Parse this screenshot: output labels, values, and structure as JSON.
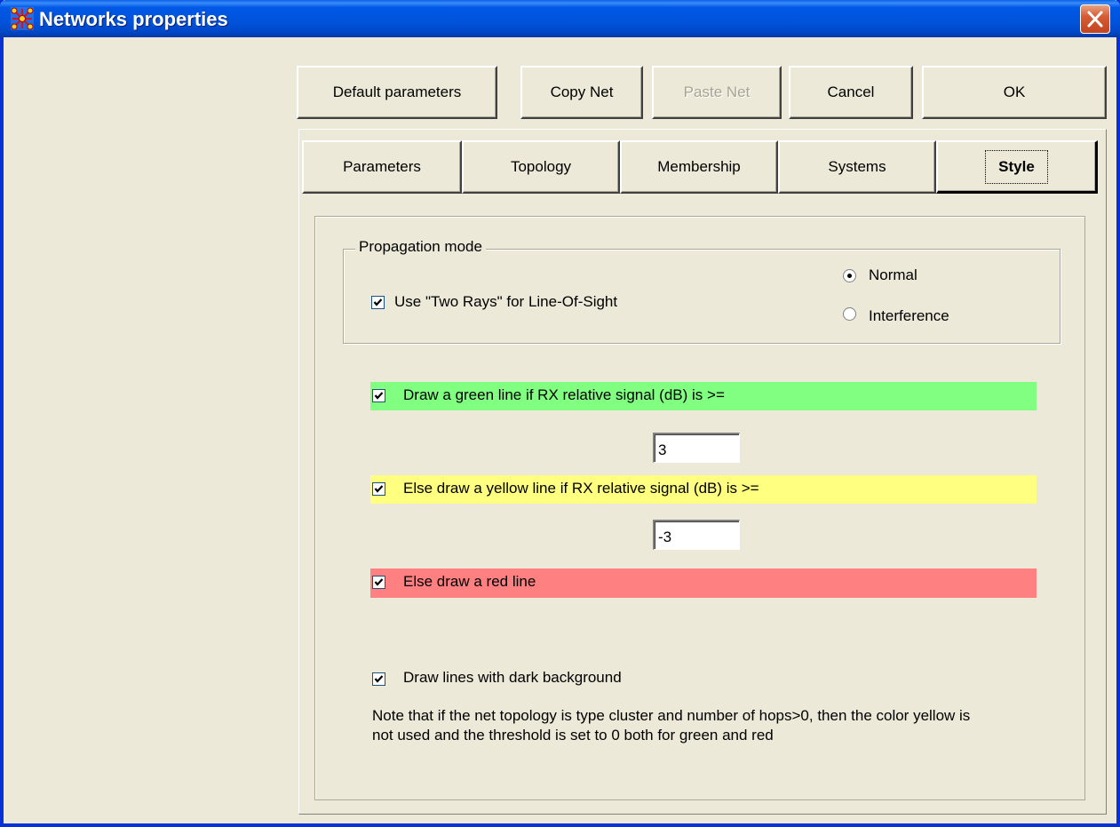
{
  "window": {
    "title": "Networks properties"
  },
  "buttons": {
    "default_parameters": "Default parameters",
    "copy_net": "Copy Net",
    "paste_net": "Paste Net",
    "cancel": "Cancel",
    "ok": "OK"
  },
  "tabs": [
    {
      "label": "Parameters"
    },
    {
      "label": "Topology"
    },
    {
      "label": "Membership"
    },
    {
      "label": "Systems"
    },
    {
      "label": "Style",
      "active": true
    }
  ],
  "propagation": {
    "legend": "Propagation mode",
    "two_rays_label": "Use \"Two Rays\" for Line-Of-Sight",
    "two_rays_checked": true,
    "mode_normal": "Normal",
    "mode_interference": "Interference",
    "selected_mode": "Normal"
  },
  "lines": {
    "green_label": "Draw a green line if RX relative signal (dB) is >=",
    "green_value": "3",
    "yellow_label": "Else draw a yellow line if RX relative signal (dB) is >=",
    "yellow_value": "-3",
    "red_label": "Else draw a red line",
    "dark_bg_label": "Draw lines with dark background"
  },
  "colors": {
    "green_band": "#80FF80",
    "yellow_band": "#FFFF80",
    "red_band": "#FF8080"
  },
  "note": "Note that if the net topology is type cluster and number of hops>0, then the color yellow is not used and the threshold is set to 0 both for green and red"
}
